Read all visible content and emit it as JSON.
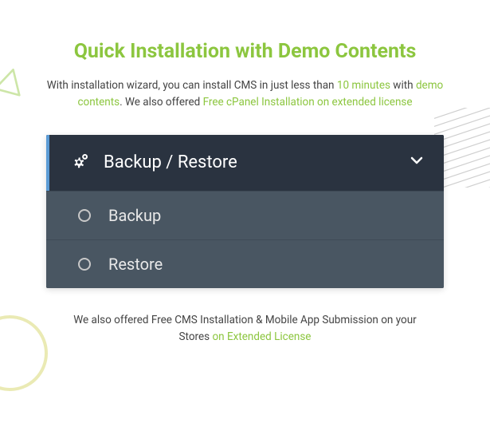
{
  "heading": "Quick Installation with Demo Contents",
  "intro": {
    "text1": "With installation wizard, you can install CMS in just less than ",
    "highlight1": "10 minutes",
    "text2": " with ",
    "highlight2": "demo contents",
    "text3": ". We also offered ",
    "highlight3": "Free cPanel Installation on extended license"
  },
  "panel": {
    "title": "Backup / Restore",
    "items": [
      {
        "label": "Backup"
      },
      {
        "label": "Restore"
      }
    ]
  },
  "footer": {
    "text1": "We also offered Free CMS Installation & Mobile App Submission on your Stores ",
    "highlight1": "on Extended License"
  }
}
